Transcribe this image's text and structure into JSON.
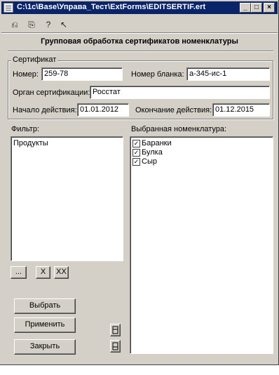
{
  "window": {
    "title": "C:\\1c\\Base\\Управа_Тест\\ExtForms\\EDITSERTIF.ert",
    "minimize": "_",
    "maximize": "□",
    "close": "×"
  },
  "toolbar": {
    "icons": [
      "open-icon",
      "save-icon",
      "help-icon",
      "whats-this-icon"
    ],
    "glyphs": [
      "⎌",
      "⎘",
      "?",
      "↖"
    ]
  },
  "form": {
    "title": "Групповая обработка сертификатов номенклатуры"
  },
  "certificate": {
    "group_label": "Сертификат",
    "number_label": "Номер:",
    "number_value": "259-78",
    "blank_label": "Номер бланка:",
    "blank_value": "а-345-ис-1",
    "organ_label": "Орган сертификации:",
    "organ_value": "Росстат",
    "start_label": "Начало действия:",
    "start_value": "01.01.2012",
    "end_label": "Окончание действия:",
    "end_value": "01.12.2015"
  },
  "filter": {
    "label": "Фильтр:",
    "items": [
      "Продукты"
    ],
    "btn_select": "...",
    "btn_clear": "X",
    "btn_clear_all": "XX"
  },
  "selected": {
    "label": "Выбранная номенклатура:",
    "items": [
      {
        "label": "Баранки",
        "checked": true
      },
      {
        "label": "Булка",
        "checked": true
      },
      {
        "label": "Сыр",
        "checked": true
      }
    ]
  },
  "buttons": {
    "choose": "Выбрать",
    "apply": "Применить",
    "close": "Закрыть"
  }
}
